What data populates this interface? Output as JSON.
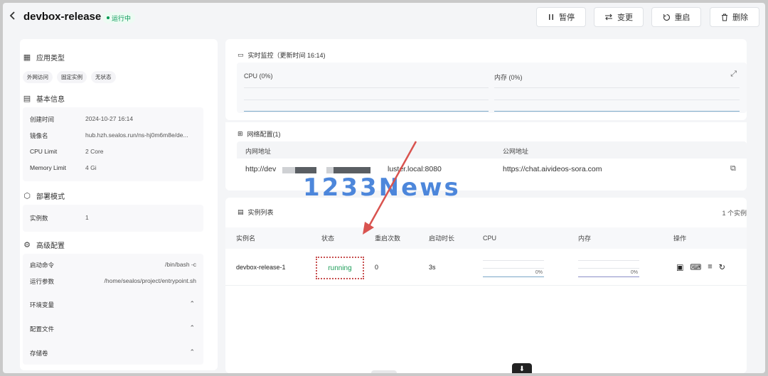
{
  "header": {
    "back_icon": "chevron-left-icon",
    "title": "devbox-release",
    "status": "运行中",
    "status_color": "#039855",
    "buttons": {
      "pause": "暂停",
      "change": "变更",
      "restart": "重启",
      "delete": "删除"
    }
  },
  "left": {
    "app_type": {
      "title": "应用类型",
      "tags": [
        "外网访问",
        "固定实例",
        "无状态"
      ]
    },
    "basic": {
      "title": "基本信息",
      "rows": [
        {
          "label": "创建时间",
          "value": "2024-10-27 16:14"
        },
        {
          "label": "镜像名",
          "value": "hub.hzh.sealos.run/ns-hj0m6m8e/de..."
        },
        {
          "label": "CPU Limit",
          "value": "2 Core"
        },
        {
          "label": "Memory Limit",
          "value": "4 Gi"
        }
      ]
    },
    "deploy": {
      "title": "部署模式",
      "rows": [
        {
          "label": "实例数",
          "value": "1"
        }
      ]
    },
    "advanced": {
      "title": "高级配置",
      "rows": [
        {
          "label": "启动命令",
          "value": "/bin/bash -c"
        },
        {
          "label": "运行参数",
          "value": "/home/sealos/project/entrypoint.sh"
        }
      ],
      "collapsibles": [
        "环境变量",
        "配置文件",
        "存储卷"
      ]
    }
  },
  "monitor": {
    "title": "实时监控（更新时间 16:14)",
    "cpu_label": "CPU  (0%)",
    "mem_label": "内存  (0%)"
  },
  "network": {
    "title": "网络配置(1)",
    "col_internal": "内网地址",
    "col_public": "公网地址",
    "internal_prefix": "http://dev",
    "internal_suffix": "luster.local:8080",
    "public_value": "https://chat.aivideos-sora.com"
  },
  "instances": {
    "title": "实例列表",
    "count": "1 个实例",
    "columns": [
      "实例名",
      "状态",
      "重启次数",
      "启动时长",
      "CPU",
      "内存",
      "操作"
    ],
    "rows": [
      {
        "name": "devbox-release-1",
        "status": "running",
        "restarts": "0",
        "uptime": "3s",
        "cpu_pct": "0%",
        "mem_pct": "0%"
      }
    ]
  },
  "watermark": "1233News",
  "colors": {
    "accent_blue": "#3a7bd8",
    "running_green": "#1e9e5a",
    "arrow_red": "#d9534f"
  }
}
